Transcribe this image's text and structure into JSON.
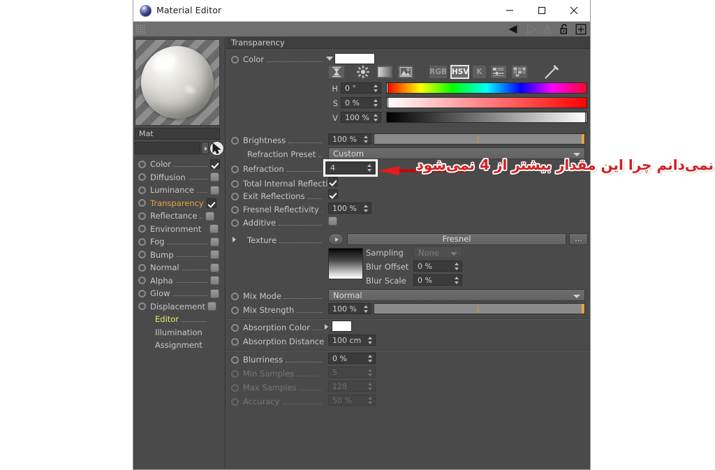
{
  "window": {
    "title": "Material Editor",
    "app_icon": "cinema4d-sphere-icon",
    "controls": {
      "minimize": "minimize-icon",
      "maximize": "maximize-icon",
      "close": "close-icon"
    }
  },
  "toolstrip": {
    "gripper": "gripper-icon",
    "icons": [
      "back-arrow-icon",
      "forward-arrow-icon",
      "tree-icon",
      "unlock-icon",
      "add-icon"
    ]
  },
  "sidebar": {
    "preview_name": "preview-sphere",
    "material_name": "Mat",
    "search_placeholder": "",
    "search_value": "",
    "channels": [
      {
        "label": "Color",
        "checked": true,
        "state": "normal"
      },
      {
        "label": "Diffusion",
        "checked": false,
        "state": "normal"
      },
      {
        "label": "Luminance",
        "checked": false,
        "state": "normal"
      },
      {
        "label": "Transparency",
        "checked": true,
        "state": "active"
      },
      {
        "label": "Reflectance",
        "checked": false,
        "state": "normal"
      },
      {
        "label": "Environment",
        "checked": false,
        "state": "normal"
      },
      {
        "label": "Fog",
        "checked": false,
        "state": "normal"
      },
      {
        "label": "Bump",
        "checked": false,
        "state": "normal"
      },
      {
        "label": "Normal",
        "checked": false,
        "state": "normal"
      },
      {
        "label": "Alpha",
        "checked": false,
        "state": "normal"
      },
      {
        "label": "Glow",
        "checked": false,
        "state": "normal"
      },
      {
        "label": "Displacement",
        "checked": false,
        "state": "normal"
      }
    ],
    "pages": [
      {
        "label": "Editor",
        "state": "lemon"
      },
      {
        "label": "Illumination",
        "state": "normal"
      },
      {
        "label": "Assignment",
        "state": "normal"
      }
    ]
  },
  "panel": {
    "section_title": "Transparency",
    "color": {
      "label": "Color",
      "swatch_hex": "#FFFFFF",
      "modes": [
        "RGB",
        "HSV",
        "K"
      ],
      "selected_mode": "HSV",
      "tool_icons": [
        "range-icon",
        "color-wheel-icon",
        "gradient-icon",
        "image-icon",
        "mixer-icon",
        "palette-icon",
        "eyedropper-icon"
      ],
      "channels": [
        {
          "label": "H",
          "value": "0 °",
          "handle": "left"
        },
        {
          "label": "S",
          "value": "0 %",
          "handle": "left"
        },
        {
          "label": "V",
          "value": "100 %",
          "handle": "right"
        }
      ]
    },
    "brightness": {
      "label": "Brightness",
      "value": "100 %"
    },
    "refraction_preset": {
      "label": "Refraction Preset",
      "value": "Custom"
    },
    "refraction": {
      "label": "Refraction",
      "value": "4",
      "highlighted": true
    },
    "total_internal_reflection": {
      "label": "Total Internal Reflection",
      "checked": true
    },
    "exit_reflections": {
      "label": "Exit Reflections",
      "checked": true
    },
    "fresnel_reflectivity": {
      "label": "Fresnel Reflectivity",
      "value": "100 %"
    },
    "additive": {
      "label": "Additive",
      "checked": false
    },
    "texture": {
      "label": "Texture",
      "value": "Fresnel",
      "more_button": "...",
      "thumbnail": "gradient-thumbnail",
      "sampling": {
        "label": "Sampling",
        "value": "None",
        "disabled": true
      },
      "blur_offset": {
        "label": "Blur Offset",
        "value": "0 %"
      },
      "blur_scale": {
        "label": "Blur Scale",
        "value": "0 %"
      }
    },
    "mix_mode": {
      "label": "Mix Mode",
      "value": "Normal"
    },
    "mix_strength": {
      "label": "Mix Strength",
      "value": "100 %"
    },
    "absorption_color": {
      "label": "Absorption Color",
      "swatch_hex": "#FFFFFF"
    },
    "absorption_distance": {
      "label": "Absorption Distance",
      "value": "100 cm"
    },
    "blurriness": {
      "label": "Blurriness",
      "value": "0 %",
      "disabled": false
    },
    "min_samples": {
      "label": "Min Samples",
      "value": "5",
      "disabled": true
    },
    "max_samples": {
      "label": "Max Samples",
      "value": "128",
      "disabled": true
    },
    "accuracy": {
      "label": "Accuracy",
      "value": "50 %",
      "disabled": true
    }
  },
  "annotation": {
    "text": "نمی‌دانم چرا این مقدار بیشتر از 4 نمی‌شود",
    "arrow": "red-left-arrow",
    "color": "#D42020"
  }
}
